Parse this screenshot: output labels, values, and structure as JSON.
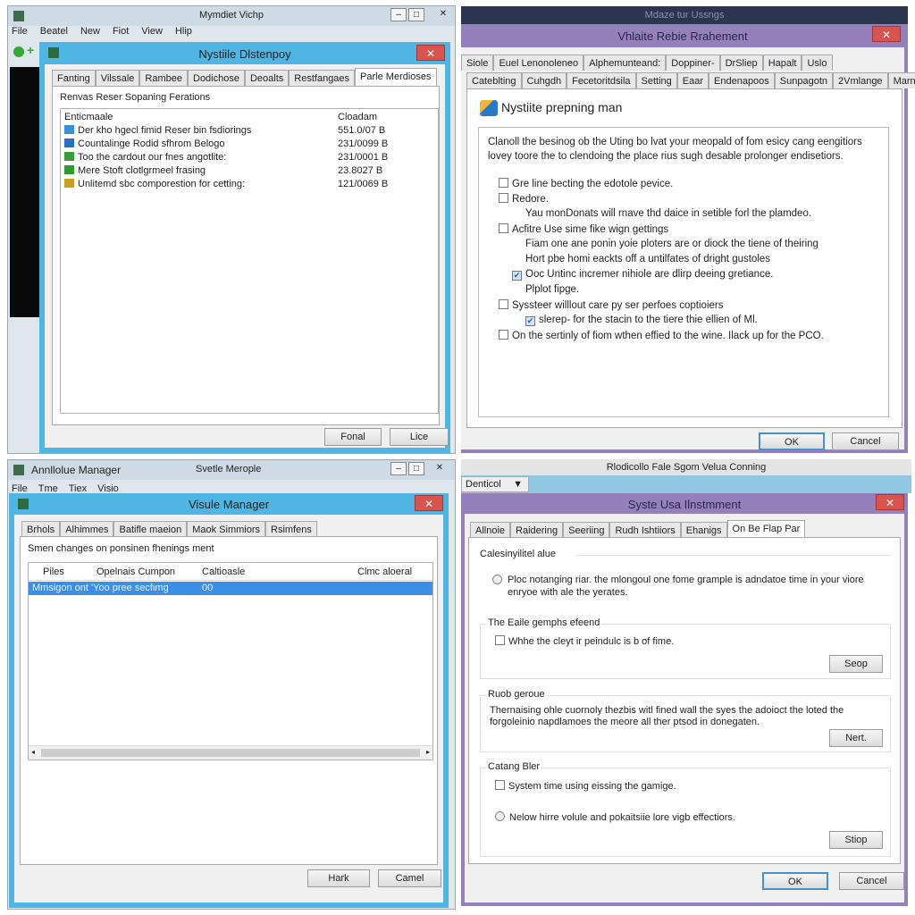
{
  "q1": {
    "window_title": "Mymdiet Vichp",
    "menu": [
      "File",
      "Beatel",
      "New",
      "Fiot",
      "View",
      "Hlip"
    ],
    "dialog_title": "Nystiile Dlstenpoy",
    "tabs": [
      "Fanting",
      "Vilssale",
      "Rambee",
      "Dodichose",
      "Deoalts",
      "Restfangaes",
      "Parle Merdioses"
    ],
    "active_tab": 6,
    "section_label": "Renvas Reser Sopaning Ferations",
    "columns": [
      "Enticmaale",
      "Cloadam"
    ],
    "rows": [
      {
        "name": "Der kho hgecl fimid Reser bin fsdiorings",
        "size": "551.0/07 B",
        "icon_color": "#3a8fd0"
      },
      {
        "name": "Countalinge Rodid sfhrom Belogo",
        "size": "231/0099 B",
        "icon_color": "#2a6fc0"
      },
      {
        "name": "Too the cardout our fnes angotlite:",
        "size": "231/0001 B",
        "icon_color": "#3c9a3c"
      },
      {
        "name": "Mere Stoft clotlgrmeel frasing",
        "size": "23.8027 B",
        "icon_color": "#2f9a2f"
      },
      {
        "name": "Unlitemd sbc comporestion for cetting:",
        "size": "121/0069 B",
        "icon_color": "#c8a020"
      }
    ],
    "buttons": {
      "primary": "Fonal",
      "secondary": "Lice"
    }
  },
  "q2": {
    "outer_title": "Mdaze tur Ussngs",
    "dialog_title": "Vhlaite Rebie Rrahement",
    "tabs_row1": [
      "Siole",
      "Euel Lenonoleneo",
      "Alphemunteand:",
      "Doppiner-",
      "DrSliep",
      "Hapalt",
      "Uslo"
    ],
    "tabs_row2": [
      "Cateblting",
      "Cuhgdh",
      "Fecetoritdsila",
      "Setting",
      "Eaar",
      "Endenapoos",
      "Sunpagotn",
      "2Vmlange",
      "Marnis"
    ],
    "heading": "Nystiite prepning man",
    "intro": "Clanoll the besinog ob the Uting bo lvat your meopald of fom esicy cang eengitiors lovey toore the to clendoing the place rius sugh desable prolonger endisetiors.",
    "options": [
      {
        "type": "check",
        "checked": false,
        "indent": 0,
        "text": "Gre line becting the edotole pevice."
      },
      {
        "type": "check",
        "checked": false,
        "indent": 0,
        "text": "Redore."
      },
      {
        "type": "text",
        "indent": 1,
        "text": "Yau monDonats will rnave thd daice in setible forl the plamdeo."
      },
      {
        "type": "check",
        "checked": false,
        "indent": 0,
        "text": "Acfitre Use sime fike wign gettings"
      },
      {
        "type": "text",
        "indent": 1,
        "text": "Fiam one ane ponin yoie ploters are or diock the tiene of theiring"
      },
      {
        "type": "text",
        "indent": 1,
        "text": "Hort pbe homi eackts off a untilfates of dright gustoles"
      },
      {
        "type": "check",
        "checked": true,
        "indent": 0.5,
        "text": "Ooc Untinc incremer nihiole are dlirp deeing gretiance."
      },
      {
        "type": "text",
        "indent": 1,
        "text": "Plplot fipge."
      },
      {
        "type": "check",
        "checked": false,
        "indent": 0,
        "text": "Syssteer willlout care py ser perfoes coptioiers"
      },
      {
        "type": "check",
        "checked": true,
        "indent": 1,
        "text": "slerep-  for the stacin to the tiere thie ellien of Ml."
      },
      {
        "type": "check",
        "checked": false,
        "indent": 0,
        "text": "On the sertinly of fiom wthen effied to the wine. Ilack up for the PCO."
      }
    ],
    "buttons": {
      "ok": "OK",
      "cancel": "Cancel"
    }
  },
  "q3": {
    "window_title": "Annllolue Manager",
    "window_subtitle": "Svetle Merople",
    "menu": [
      "File",
      "Tme",
      "Tiex",
      "Visio"
    ],
    "dialog_title": "Visule Manager",
    "tabs": [
      "Brhols",
      "Alhimmes",
      "Batifle maeion",
      "Maok Simmiors",
      "Rsimfens"
    ],
    "section_label": "Smen changes on ponsinen fhenings ment",
    "columns": [
      "Piles",
      "Opelnais Cumpon",
      "Caltioasle",
      "Clmc aloeral"
    ],
    "selected_row": {
      "name": "Mmsigon ont 'Yoo pree secfimg",
      "value": "00"
    },
    "buttons": {
      "primary": "Hark",
      "secondary": "Camel"
    }
  },
  "q4": {
    "outer_title": "Rlodicollo Fale Sgom Velua Conning",
    "dropdown_value": "Denticol",
    "dialog_title": "Syste Usa Ilnstmment",
    "tabs": [
      "Allnoie",
      "Raidering",
      "Seeriing",
      "Rudh Ishtiiors",
      "Ehanigs",
      "On Be Flap Par"
    ],
    "active_tab": 5,
    "group1": {
      "label": "Calesinyilitel alue",
      "radio_text": "Ploc notanging riar. the mlongoul one fome grample is adndatoe time in your viore enryoe with ale the yerates."
    },
    "group2": {
      "label": "The Eaile gemphs efeend",
      "check_text": "Whhe the cleyt ir peindulc is b of fime.",
      "button": "Seop"
    },
    "group3": {
      "label": "Ruob geroue",
      "text": "Thernaising ohle cuornoly thezbis witl fined wall the syes the adoioct the loted the forgoleinio napdlamoes the meore all ther ptsod in donegaten.",
      "button": "Nert."
    },
    "group4": {
      "label": "Catang Bler",
      "check_text": "System time using eissing the gamige.",
      "radio_text": "Nelow hirre volule and pokaitsiie lore vigb effectiors.",
      "button": "Stiop"
    },
    "buttons": {
      "ok": "OK",
      "cancel": "Cancel"
    }
  },
  "colors": {
    "dialog_blue": "#4fb6e3",
    "dialog_purple": "#9480bb",
    "close_red": "#d9534f",
    "selection": "#3d8ee6"
  }
}
